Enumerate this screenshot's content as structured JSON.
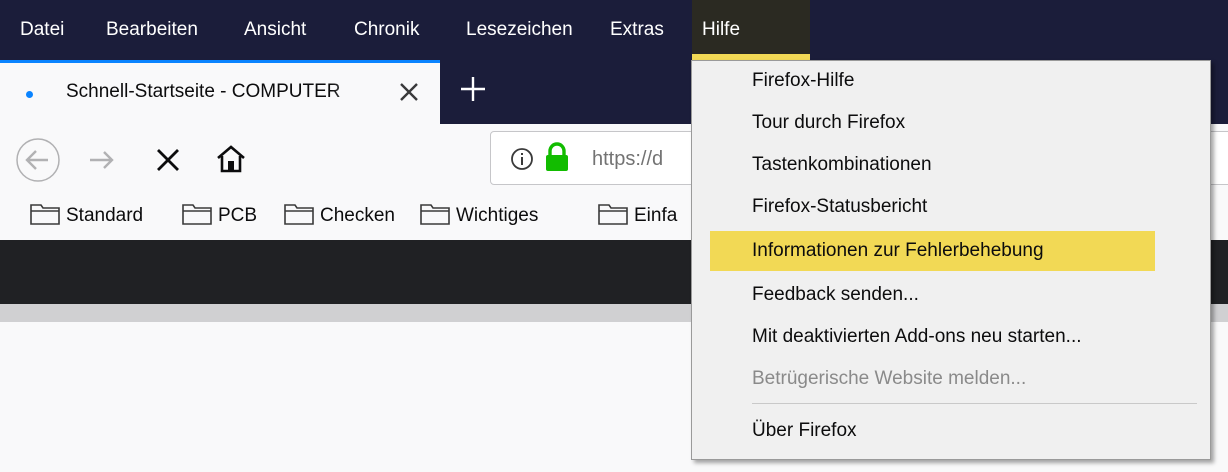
{
  "menubar": {
    "items": [
      "Datei",
      "Bearbeiten",
      "Ansicht",
      "Chronik",
      "Lesezeichen",
      "Extras",
      "Hilfe"
    ],
    "active": "Hilfe"
  },
  "tab": {
    "title": "Schnell-Startseite - COMPUTER",
    "close_icon": "close-icon",
    "new_tab_icon": "plus-icon"
  },
  "navbar": {
    "url_text": "https://d",
    "icons": [
      "back-arrow-icon",
      "forward-arrow-icon",
      "stop-icon",
      "home-icon",
      "info-icon",
      "lock-icon"
    ]
  },
  "bookmarks": {
    "items": [
      "Standard",
      "PCB",
      "Checken",
      "Wichtiges",
      "Einfa"
    ],
    "icon": "folder-icon"
  },
  "help_menu": {
    "items": [
      "Firefox-Hilfe",
      "Tour durch Firefox",
      "Tastenkombinationen",
      "Firefox-Statusbericht",
      "Informationen zur Fehlerbehebung",
      "Feedback senden...",
      "Mit deaktivierten Add-ons neu starten...",
      "Betrügerische Website melden...",
      "Über Firefox"
    ],
    "highlighted": "Informationen zur Fehlerbehebung",
    "disabled": "Betrügerische Website melden..."
  },
  "colors": {
    "menubar_bg": "#1b1d3a",
    "highlight": "#f2d955",
    "accent": "#0a84ff",
    "lock_green": "#12bc00"
  }
}
